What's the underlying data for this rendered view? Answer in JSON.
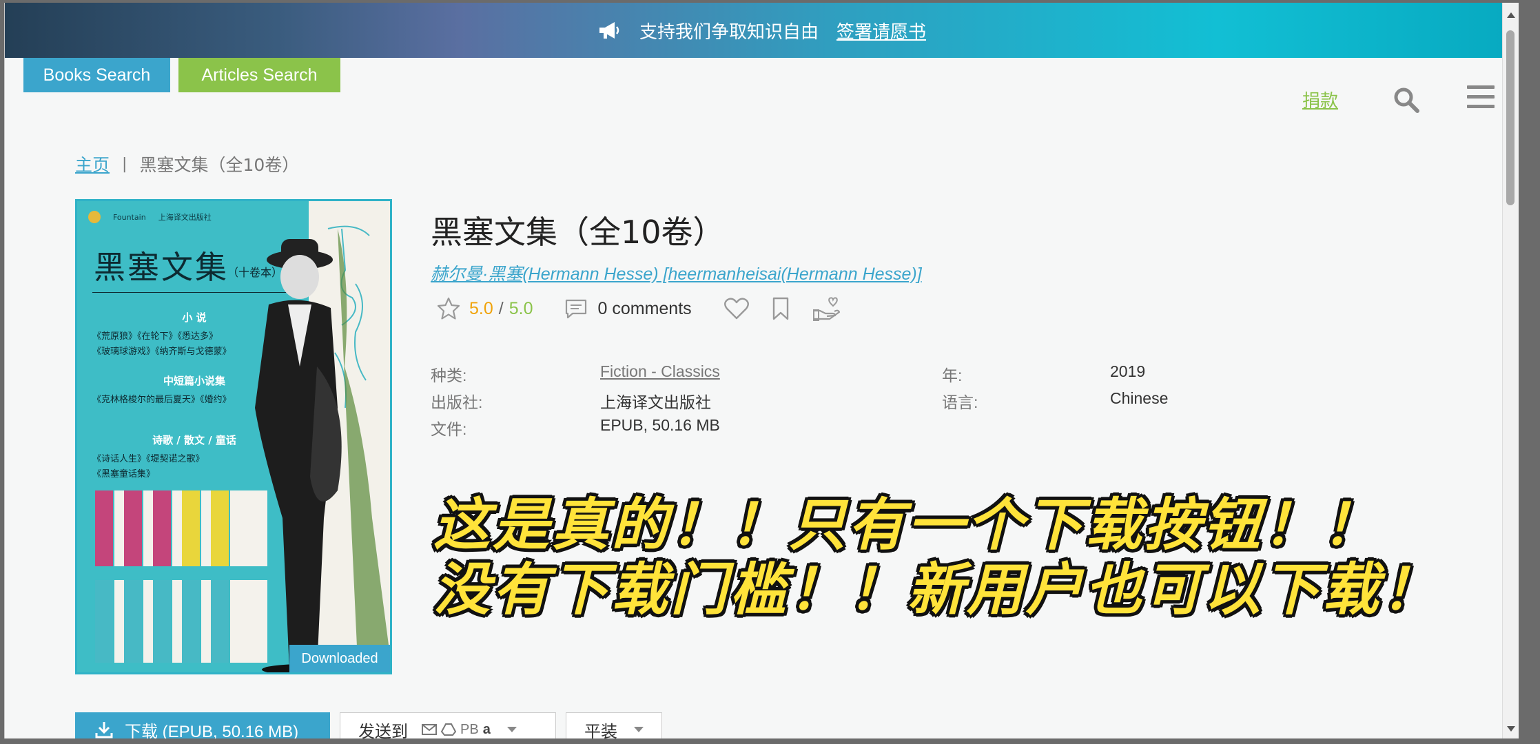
{
  "banner": {
    "icon": "megaphone-icon",
    "text": "支持我们争取知识自由",
    "link": "签署请愿书"
  },
  "tabs": {
    "books": "Books Search",
    "articles": "Articles Search"
  },
  "header": {
    "donate": "捐款",
    "search_icon": "search-icon",
    "menu_icon": "menu-icon",
    "donate_color": "#8bc34a"
  },
  "breadcrumb": {
    "home": "主页",
    "separator": "|",
    "current": "黑塞文集（全10卷）"
  },
  "cover": {
    "publisher_brand": "Fountain",
    "publisher": "上海译文出版社",
    "title": "黑塞文集",
    "volumes": "（十卷本）",
    "section_1": "小 说",
    "works_1": [
      "《荒原狼》《在轮下》《悉达多》",
      "《玻璃球游戏》《纳齐斯与戈德蒙》"
    ],
    "section_2": "中短篇小说集",
    "works_2": [
      "《克林格梭尔的最后夏天》《婚约》"
    ],
    "section_3": "诗歌 / 散文 / 童话",
    "works_3": [
      "《诗话人生》《堤契诺之歌》",
      "《黑塞童话集》"
    ],
    "badge": "Downloaded"
  },
  "book": {
    "title": "黑塞文集（全10卷）",
    "author": "赫尔曼·黑塞(Hermann Hesse) [heermanheisai(Hermann Hesse)]",
    "rating": "5.0",
    "rating_sep": "/",
    "rating_max": "5.0",
    "comments": "0 comments",
    "accent_color": "#3ba5cc"
  },
  "properties": {
    "category_label": "种类:",
    "category_value": "Fiction - Classics",
    "year_label": "年:",
    "year_value": "2019",
    "publisher_label": "出版社:",
    "publisher_value": "上海译文出版社",
    "language_label": "语言:",
    "language_value": "Chinese",
    "file_label": "文件:",
    "file_value": "EPUB, 50.16 MB"
  },
  "caption": {
    "line1": "这是真的！！只有一个下载按钮！！",
    "line2": "没有下载门槛！！新用户也可以下载！",
    "color": "#ffe33a"
  },
  "actions": {
    "download": "下载 (EPUB, 50.16 MB)",
    "send_to": "发送到",
    "send_pb": "PB",
    "send_a": "a",
    "format": "平装"
  }
}
